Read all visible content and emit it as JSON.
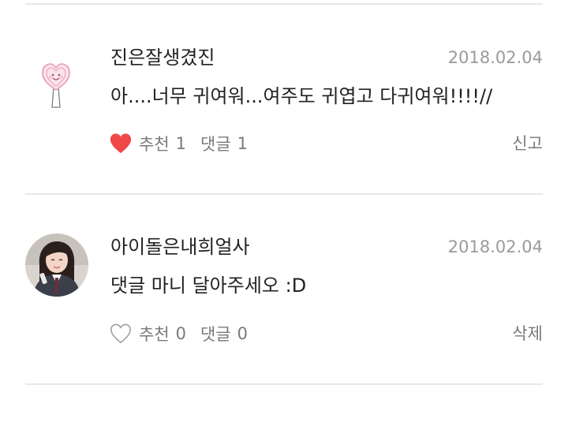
{
  "comments": [
    {
      "username": "진은잘생겼진",
      "date": "2018.02.04",
      "text": "아....너무 귀여워...여주도 귀엽고 다귀여워!!!!//",
      "like_label": "추천",
      "like_count": "1",
      "reply_label": "댓글",
      "reply_count": "1",
      "liked": true,
      "side_action": "신고",
      "avatar_icon": "heart-lollipop-icon"
    },
    {
      "username": "아이돌은내희얼사",
      "date": "2018.02.04",
      "text": "댓글 마니 달아주세오 :D",
      "like_label": "추천",
      "like_count": "0",
      "reply_label": "댓글",
      "reply_count": "0",
      "liked": false,
      "side_action": "삭제",
      "avatar_icon": "profile-photo"
    }
  ],
  "colors": {
    "liked_heart": "#f04848",
    "empty_heart": "#9a9a9a",
    "divider": "#e8e8e8",
    "date": "#9a9a9a",
    "text": "#222222"
  }
}
